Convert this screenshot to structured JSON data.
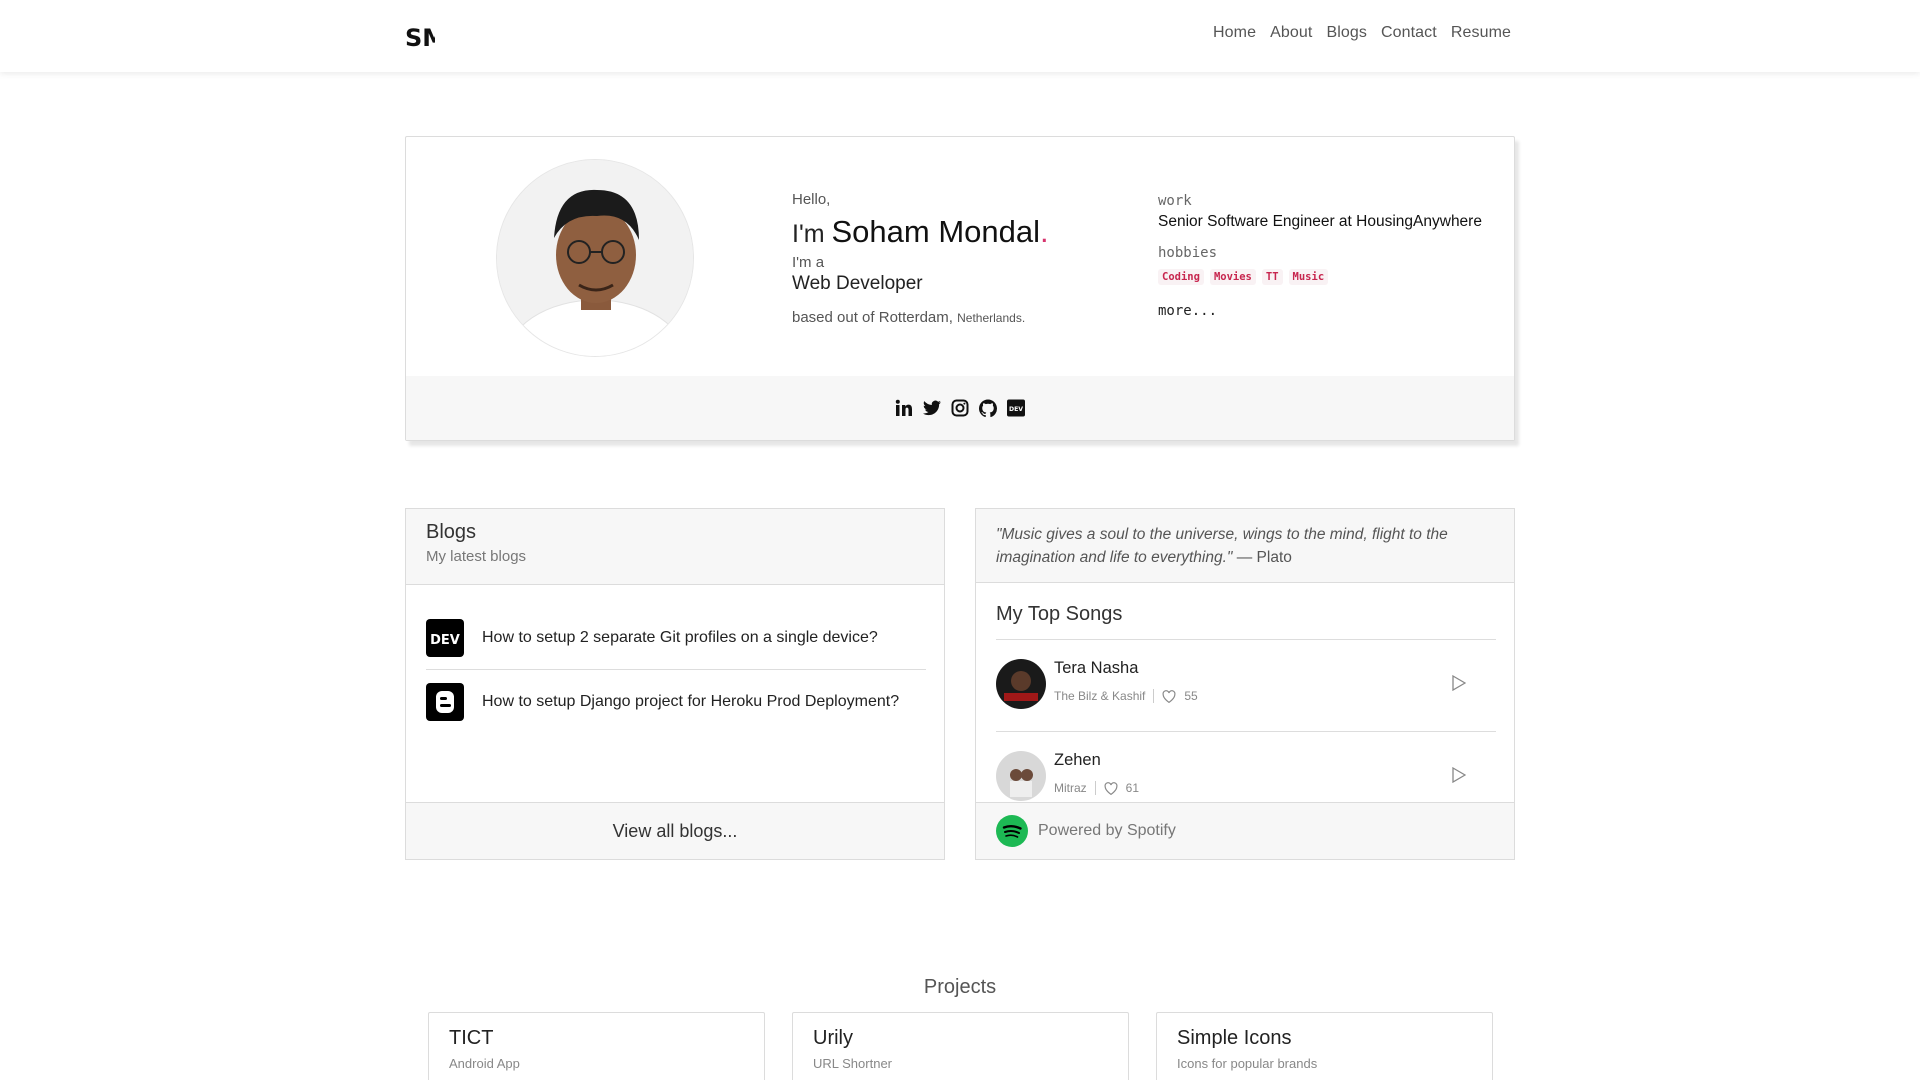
{
  "nav": {
    "logo_text": "SM",
    "links": [
      "Home",
      "About",
      "Blogs",
      "Contact",
      "Resume"
    ]
  },
  "hero": {
    "hello": "Hello,",
    "im": "I'm",
    "name": "Soham Mondal",
    "name_dot": ".",
    "ima": "I'm a",
    "role": "Web Developer",
    "based": "based out of Rotterdam,",
    "country": "Netherlands.",
    "work_label": "work",
    "work_value": "Senior Software Engineer at HousingAnywhere",
    "hobbies_label": "hobbies",
    "hobbies": [
      "Coding",
      "Movies",
      "TT",
      "Music"
    ],
    "more": "more...",
    "socials": [
      "linkedin-icon",
      "twitter-icon",
      "instagram-icon",
      "github-icon",
      "dev-icon"
    ]
  },
  "blogs": {
    "title": "Blogs",
    "subtitle": "My latest blogs",
    "items": [
      {
        "icon": "dev-icon",
        "title": "How to setup 2 separate Git profiles on a single device?"
      },
      {
        "icon": "blogger-icon",
        "title": "How to setup Django project for Heroku Prod Deployment?"
      }
    ],
    "footer": "View all blogs..."
  },
  "spotify": {
    "quote": "\"Music gives a soul to the universe, wings to the mind, flight to the imagination and life to everything.\"",
    "quote_author": "— Plato",
    "title": "My Top Songs",
    "songs": [
      {
        "name": "Tera Nasha",
        "artist": "The Bilz & Kashif",
        "likes": "55"
      },
      {
        "name": "Zehen",
        "artist": "Mitraz",
        "likes": "61"
      }
    ],
    "footer": "Powered by Spotify",
    "accent": "#1DB954"
  },
  "projects": {
    "title": "Projects",
    "items": [
      {
        "name": "TICT",
        "desc": "Android App"
      },
      {
        "name": "Urily",
        "desc": "URL Shortner"
      },
      {
        "name": "Simple Icons",
        "desc": "Icons for popular brands"
      }
    ]
  }
}
